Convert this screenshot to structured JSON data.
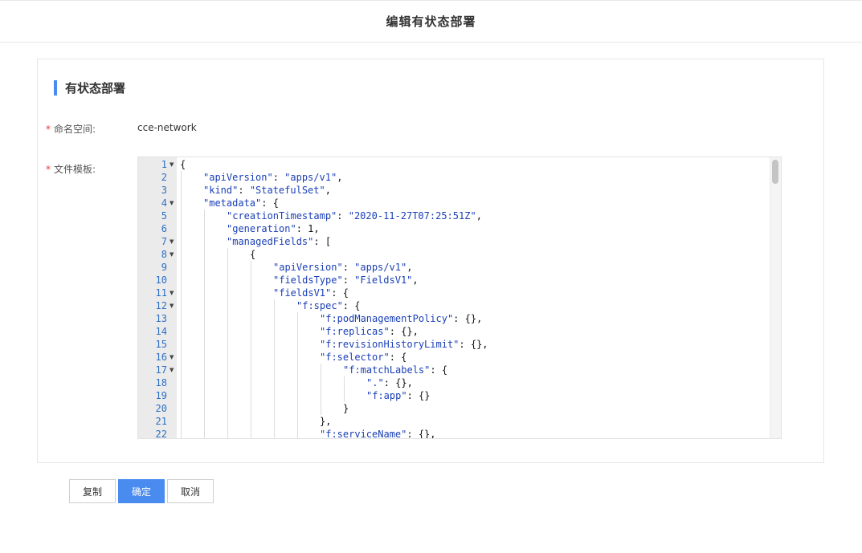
{
  "header": {
    "title": "编辑有状态部署"
  },
  "section": {
    "title": "有状态部署"
  },
  "form": {
    "namespace_label": "命名空间:",
    "namespace_value": "cce-network",
    "template_label": "文件模板:",
    "required_mark": "*"
  },
  "editor": {
    "lines": [
      {
        "n": "1",
        "fold": true,
        "indent": 0,
        "text": "{"
      },
      {
        "n": "2",
        "fold": false,
        "indent": 1,
        "key": "\"apiVersion\"",
        "rest": ": ",
        "val": "\"apps/v1\"",
        "end": ","
      },
      {
        "n": "3",
        "fold": false,
        "indent": 1,
        "key": "\"kind\"",
        "rest": ": ",
        "val": "\"StatefulSet\"",
        "end": ","
      },
      {
        "n": "4",
        "fold": true,
        "indent": 1,
        "key": "\"metadata\"",
        "rest": ": {",
        "val": "",
        "end": ""
      },
      {
        "n": "5",
        "fold": false,
        "indent": 2,
        "key": "\"creationTimestamp\"",
        "rest": ": ",
        "val": "\"2020-11-27T07:25:51Z\"",
        "end": ","
      },
      {
        "n": "6",
        "fold": false,
        "indent": 2,
        "key": "\"generation\"",
        "rest": ": 1,",
        "val": "",
        "end": ""
      },
      {
        "n": "7",
        "fold": true,
        "indent": 2,
        "key": "\"managedFields\"",
        "rest": ": [",
        "val": "",
        "end": ""
      },
      {
        "n": "8",
        "fold": true,
        "indent": 3,
        "text": "{"
      },
      {
        "n": "9",
        "fold": false,
        "indent": 4,
        "key": "\"apiVersion\"",
        "rest": ": ",
        "val": "\"apps/v1\"",
        "end": ","
      },
      {
        "n": "10",
        "fold": false,
        "indent": 4,
        "key": "\"fieldsType\"",
        "rest": ": ",
        "val": "\"FieldsV1\"",
        "end": ","
      },
      {
        "n": "11",
        "fold": true,
        "indent": 4,
        "key": "\"fieldsV1\"",
        "rest": ": {",
        "val": "",
        "end": ""
      },
      {
        "n": "12",
        "fold": true,
        "indent": 5,
        "key": "\"f:spec\"",
        "rest": ": {",
        "val": "",
        "end": ""
      },
      {
        "n": "13",
        "fold": false,
        "indent": 6,
        "key": "\"f:podManagementPolicy\"",
        "rest": ": {},",
        "val": "",
        "end": ""
      },
      {
        "n": "14",
        "fold": false,
        "indent": 6,
        "key": "\"f:replicas\"",
        "rest": ": {},",
        "val": "",
        "end": ""
      },
      {
        "n": "15",
        "fold": false,
        "indent": 6,
        "key": "\"f:revisionHistoryLimit\"",
        "rest": ": {},",
        "val": "",
        "end": ""
      },
      {
        "n": "16",
        "fold": true,
        "indent": 6,
        "key": "\"f:selector\"",
        "rest": ": {",
        "val": "",
        "end": ""
      },
      {
        "n": "17",
        "fold": true,
        "indent": 7,
        "key": "\"f:matchLabels\"",
        "rest": ": {",
        "val": "",
        "end": ""
      },
      {
        "n": "18",
        "fold": false,
        "indent": 8,
        "key": "\".\"",
        "rest": ": {},",
        "val": "",
        "end": ""
      },
      {
        "n": "19",
        "fold": false,
        "indent": 8,
        "key": "\"f:app\"",
        "rest": ": {}",
        "val": "",
        "end": ""
      },
      {
        "n": "20",
        "fold": false,
        "indent": 7,
        "text": "}"
      },
      {
        "n": "21",
        "fold": false,
        "indent": 6,
        "text": "},"
      },
      {
        "n": "22",
        "fold": false,
        "indent": 6,
        "key": "\"f:serviceName\"",
        "rest": ": {},",
        "val": "",
        "end": ""
      }
    ]
  },
  "buttons": {
    "copy": "复制",
    "ok": "确定",
    "cancel": "取消"
  },
  "colors": {
    "accent": "#4a8bf0",
    "required": "#e53935",
    "code_string": "#1a3fb6",
    "line_number": "#2c6fc4"
  }
}
